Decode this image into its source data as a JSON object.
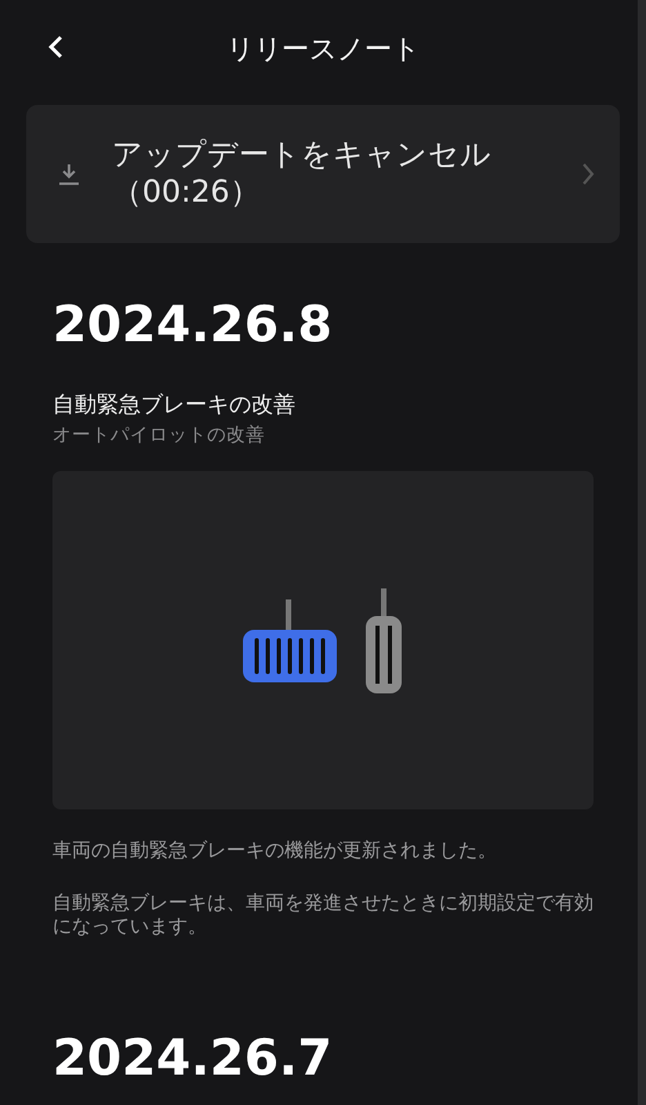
{
  "header": {
    "title": "リリースノート"
  },
  "cancel_update": {
    "label": "アップデートをキャンセル（00:26）"
  },
  "releases": [
    {
      "version": "2024.26.8",
      "features": [
        {
          "title": "自動緊急ブレーキの改善",
          "subtitle": "オートパイロットの改善",
          "paragraphs": [
            "車両の自動緊急ブレーキの機能が更新されました。",
            "自動緊急ブレーキは、車両を発進させたときに初期設定で有効になっています。"
          ]
        }
      ]
    },
    {
      "version": "2024.26.7"
    }
  ]
}
